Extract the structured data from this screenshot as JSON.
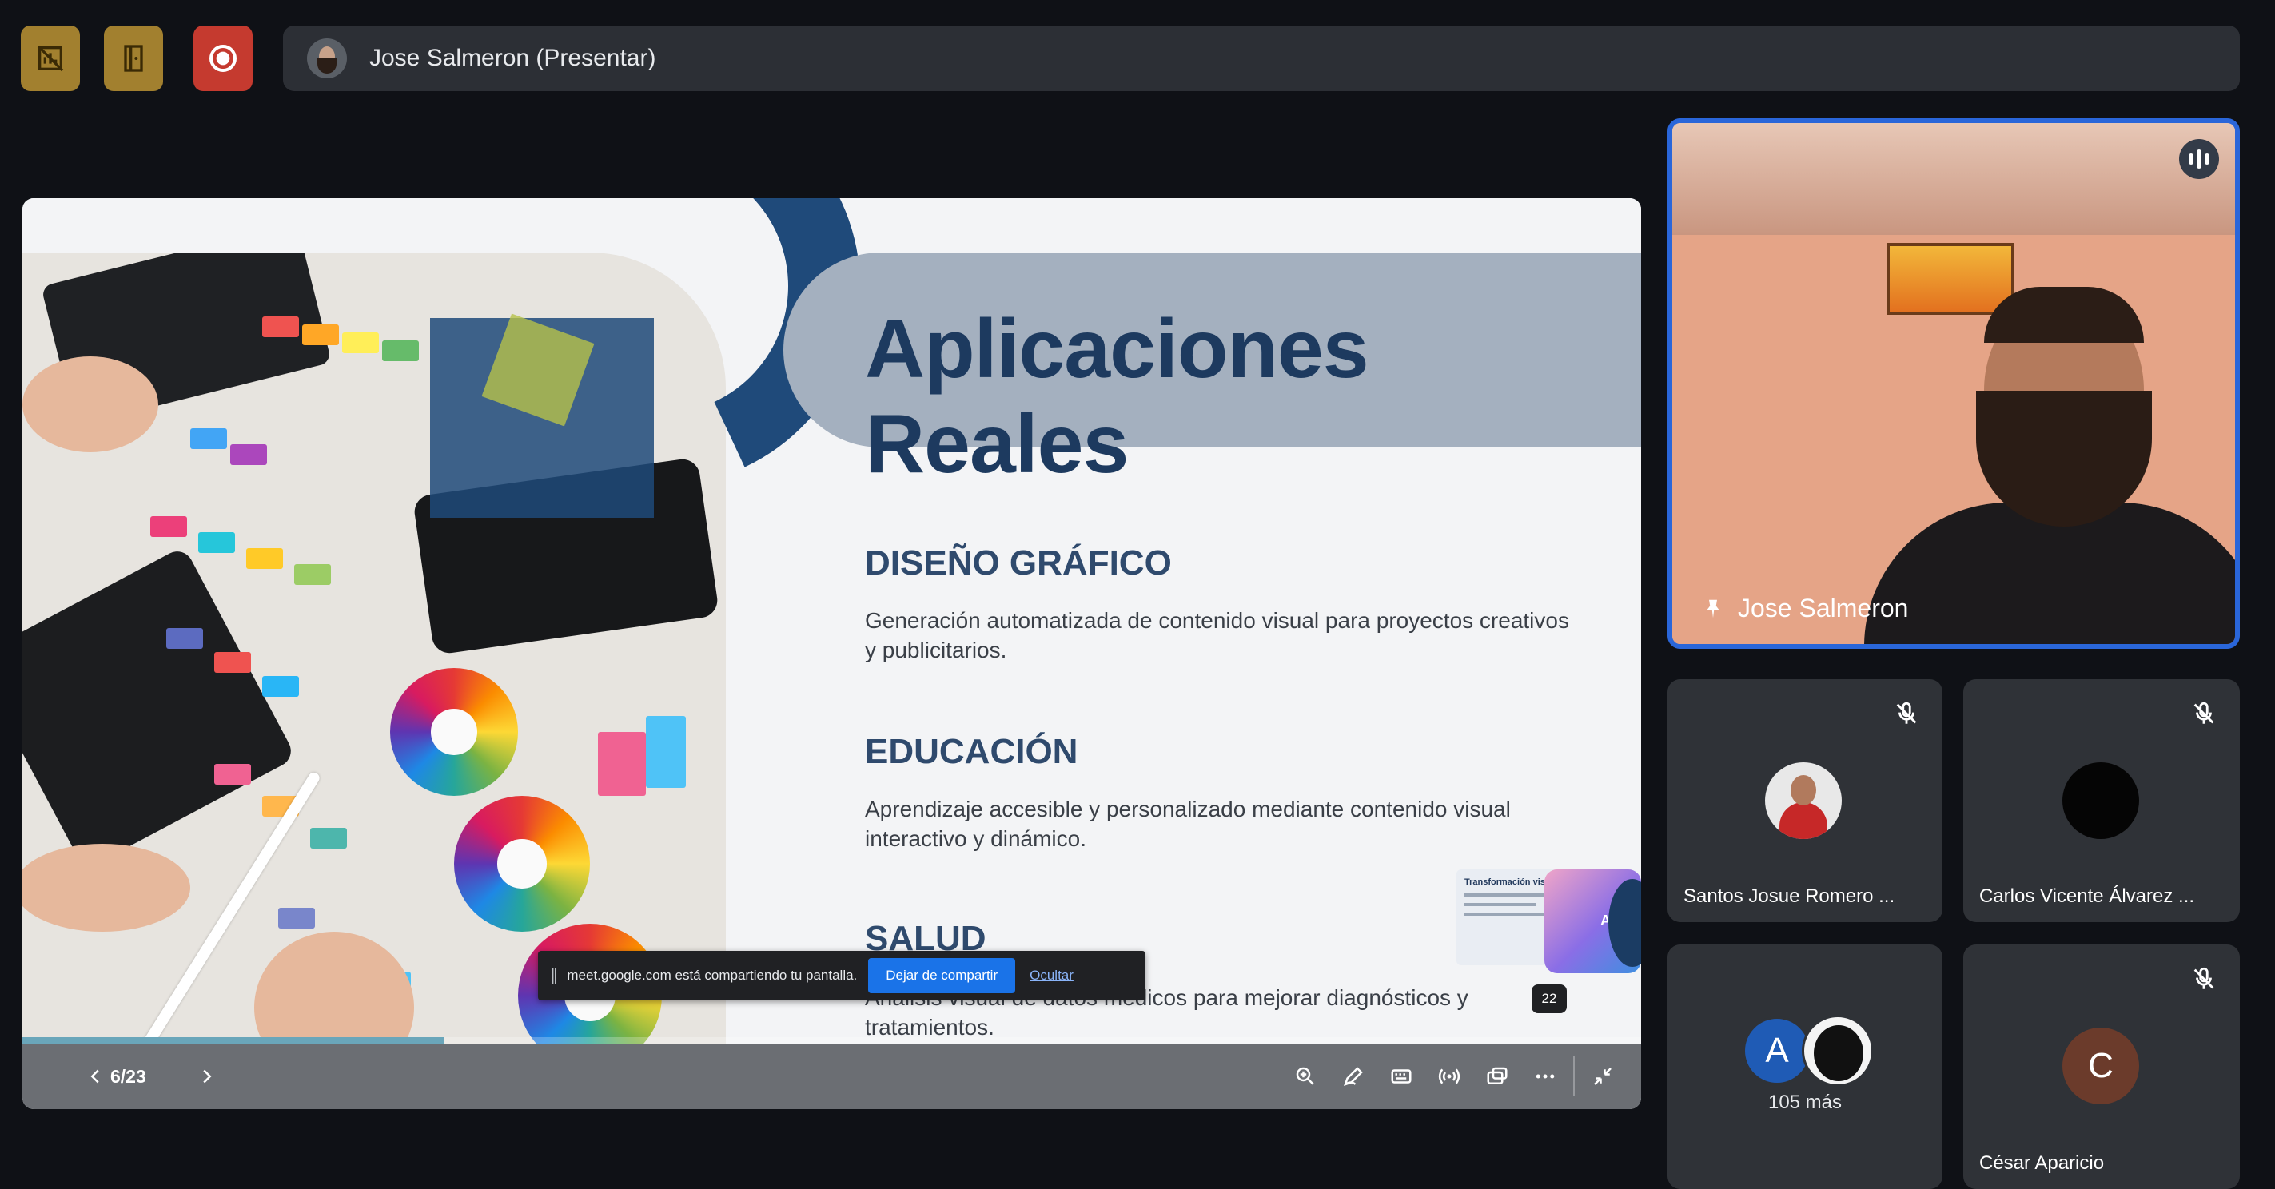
{
  "top_bar": {
    "buttons": [
      {
        "icon": "no-chart-icon",
        "color": "#a2802f"
      },
      {
        "icon": "door-exit-icon",
        "color": "#a2802f"
      },
      {
        "icon": "record-icon",
        "color": "#c53a2f"
      }
    ],
    "presenter_label": "Jose Salmeron (Presentar)"
  },
  "slide": {
    "title": "Aplicaciones Reales",
    "sections": [
      {
        "heading": "DISEÑO GRÁFICO",
        "text": "Generación automatizada de contenido visual para proyectos creativos y publicitarios."
      },
      {
        "heading": "EDUCACIÓN",
        "text": "Aprendizaje accesible y personalizado mediante contenido visual interactivo y dinámico."
      },
      {
        "heading": "SALUD",
        "text": "Análisis visual de datos médicos para mejorar diagnósticos y tratamientos."
      }
    ],
    "thumbnail_title": "Transformación visual",
    "thumbnail_badge": "AI",
    "page_badge": "22"
  },
  "share_notice": {
    "message": "meet.google.com está compartiendo tu pantalla.",
    "stop_label": "Dejar de compartir",
    "hide_label": "Ocultar"
  },
  "controls": {
    "page_indicator": "6/23",
    "progress_fraction": 0.26
  },
  "participants": {
    "main": {
      "name": "Jose Salmeron"
    },
    "tiles": [
      {
        "name": "Santos Josue Romero ...",
        "muted": true
      },
      {
        "name": "Carlos Vicente Álvarez ...",
        "muted": true
      },
      {
        "more_label": "105 más",
        "avatar_letter": "A",
        "avatar_color": "#1f5bb5"
      },
      {
        "name": "César Aparicio",
        "muted": true,
        "avatar_letter": "C",
        "avatar_color": "#6b3b2b"
      }
    ]
  }
}
